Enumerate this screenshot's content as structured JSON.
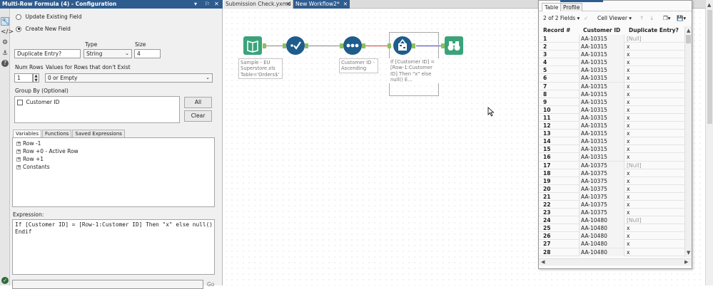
{
  "config_panel": {
    "title": "Multi-Row Formula (4) - Configuration",
    "title_controls": "▾ ✕ ✕",
    "radio_update": "Update Existing Field",
    "radio_create": "Create New  Field",
    "type_label": "Type",
    "size_label": "Size",
    "field_name": "Duplicate Entry?",
    "type_value": "String",
    "size_value": "4",
    "num_rows_label": "Num Rows",
    "values_label": "Values for Rows that don't Exist",
    "num_rows_value": "1",
    "values_option": "0 or Empty",
    "group_by_label": "Group By (Optional)",
    "group_by_field": "Customer ID",
    "all_button": "All",
    "clear_button": "Clear",
    "tabs": [
      "Variables",
      "Functions",
      "Saved Expressions"
    ],
    "variables": [
      "Row -1",
      "Row +0 - Active Row",
      "Row +1",
      "Constants"
    ],
    "expression_label": "Expression:",
    "expression_line1": "If [Customer ID] = [Row-1:Customer ID] Then \"x\" else null()",
    "expression_line2": "Endif",
    "go_button": "Go"
  },
  "workflow": {
    "tabs": [
      "Submission Check.yxmd",
      "New Workflow2*"
    ],
    "tab_close": "✕",
    "tools": [
      {
        "name": "input",
        "label_lines": [
          "Sample - EU",
          "Superstore.xls",
          "Table='Orders$'"
        ]
      },
      {
        "name": "select"
      },
      {
        "name": "sort",
        "label_lines": [
          "Customer ID -",
          "Ascending"
        ]
      },
      {
        "name": "multi-row-formula",
        "label_lines": [
          "If [Customer ID] =",
          "[Row-1:Customer",
          "ID] Then \"x\" else",
          "null() E..."
        ]
      },
      {
        "name": "browse"
      }
    ]
  },
  "results": {
    "tabs": [
      "Table",
      "Profile"
    ],
    "fields_count": "2 of 2 Fields",
    "cell_viewer": "Cell Viewer",
    "columns": [
      "Record #",
      "Customer ID",
      "Duplicate Entry?"
    ],
    "rows": [
      [
        "1",
        "AA-10315",
        "[Null]"
      ],
      [
        "2",
        "AA-10315",
        "x"
      ],
      [
        "3",
        "AA-10315",
        "x"
      ],
      [
        "4",
        "AA-10315",
        "x"
      ],
      [
        "5",
        "AA-10315",
        "x"
      ],
      [
        "6",
        "AA-10315",
        "x"
      ],
      [
        "7",
        "AA-10315",
        "x"
      ],
      [
        "8",
        "AA-10315",
        "x"
      ],
      [
        "9",
        "AA-10315",
        "x"
      ],
      [
        "10",
        "AA-10315",
        "x"
      ],
      [
        "11",
        "AA-10315",
        "x"
      ],
      [
        "12",
        "AA-10315",
        "x"
      ],
      [
        "13",
        "AA-10315",
        "x"
      ],
      [
        "14",
        "AA-10315",
        "x"
      ],
      [
        "15",
        "AA-10315",
        "x"
      ],
      [
        "16",
        "AA-10315",
        "x"
      ],
      [
        "17",
        "AA-10375",
        "[Null]"
      ],
      [
        "18",
        "AA-10375",
        "x"
      ],
      [
        "19",
        "AA-10375",
        "x"
      ],
      [
        "20",
        "AA-10375",
        "x"
      ],
      [
        "21",
        "AA-10375",
        "x"
      ],
      [
        "22",
        "AA-10375",
        "x"
      ],
      [
        "23",
        "AA-10375",
        "x"
      ],
      [
        "24",
        "AA-10480",
        "[Null]"
      ],
      [
        "25",
        "AA-10480",
        "x"
      ],
      [
        "26",
        "AA-10480",
        "x"
      ],
      [
        "27",
        "AA-10480",
        "x"
      ],
      [
        "28",
        "AA-10480",
        "x"
      ]
    ]
  },
  "colors": {
    "titlebar": "#2f5c8f",
    "input_tool": "#3aa37a",
    "select_tool": "#1e5c8c",
    "sort_tool": "#1e5c8c",
    "formula_tool": "#1e5c8c",
    "browse_tool": "#3aa37a",
    "anchor": "#8fbf5e"
  }
}
